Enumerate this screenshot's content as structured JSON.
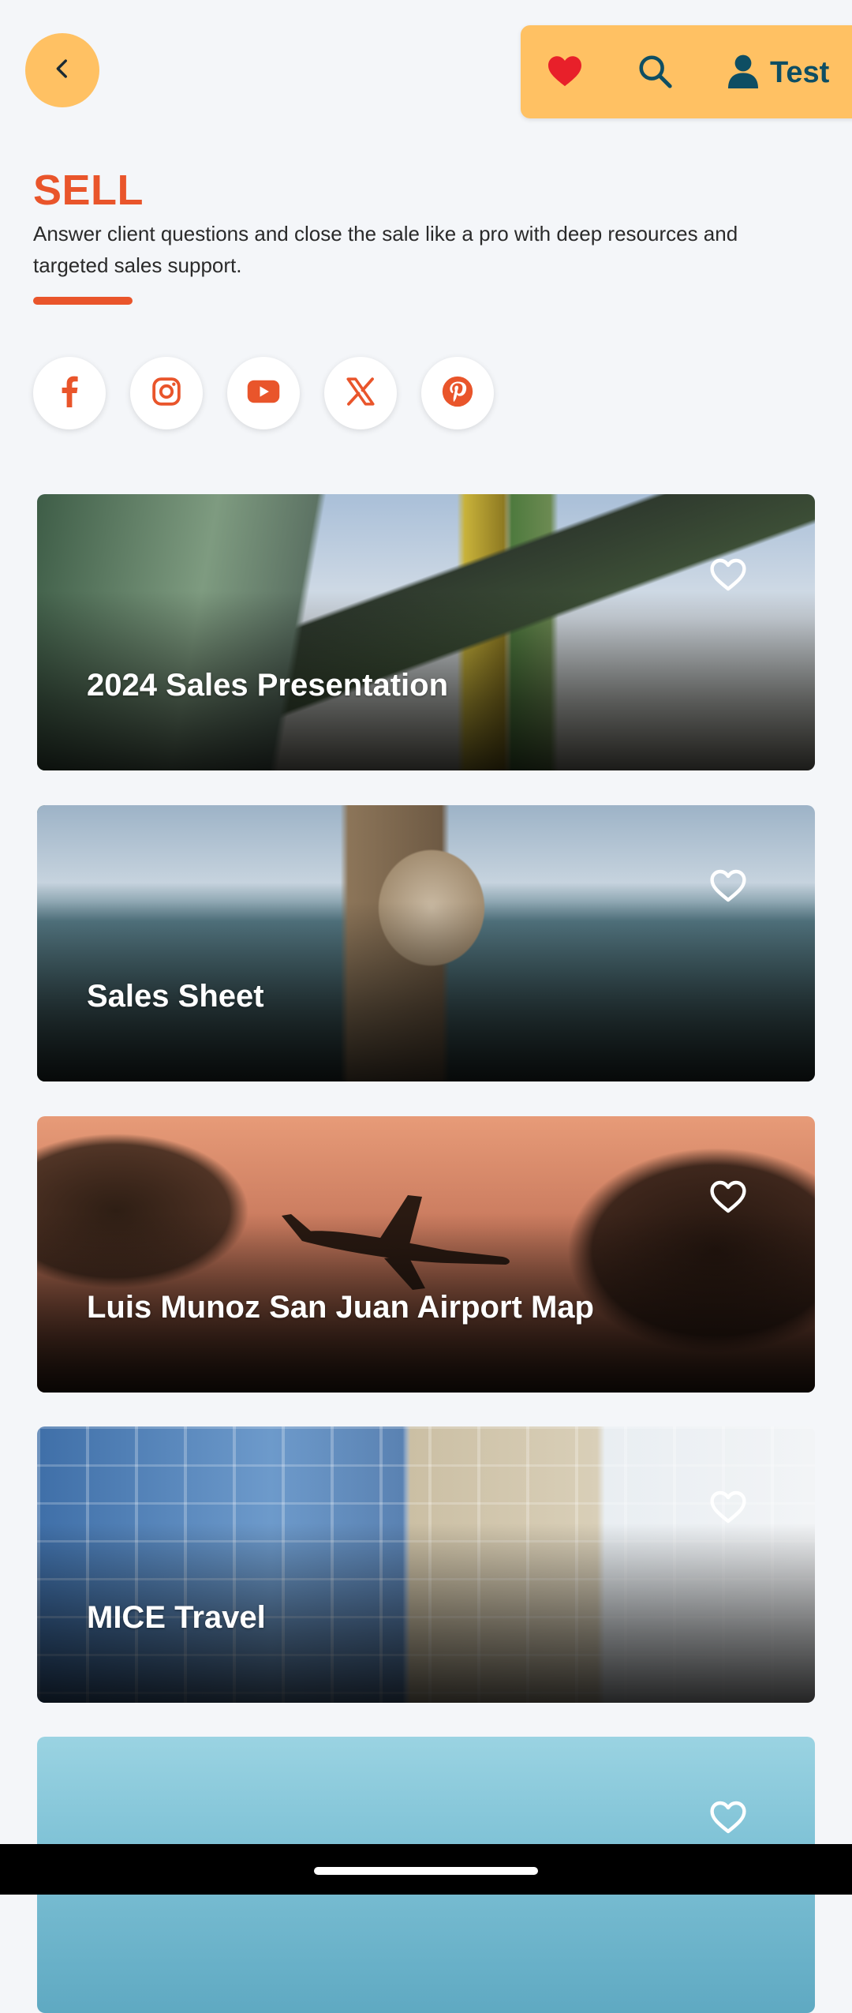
{
  "header": {
    "back_icon": "chevron-left-icon",
    "favorites_icon": "heart-icon",
    "search_icon": "search-icon",
    "user_icon": "user-icon",
    "user_name": "Test"
  },
  "section": {
    "title": "SELL",
    "description": "Answer client questions and close the sale like a pro with deep resources and targeted sales support."
  },
  "social": [
    {
      "icon": "facebook-icon"
    },
    {
      "icon": "instagram-icon"
    },
    {
      "icon": "youtube-icon"
    },
    {
      "icon": "x-icon"
    },
    {
      "icon": "pinterest-icon"
    }
  ],
  "cards": [
    {
      "title": "2024 Sales Presentation",
      "favorite": false
    },
    {
      "title": "Sales Sheet",
      "favorite": false
    },
    {
      "title": "Luis Munoz San Juan Airport Map",
      "favorite": false
    },
    {
      "title": "MICE Travel",
      "favorite": false
    },
    {
      "title": "",
      "favorite": false
    }
  ],
  "colors": {
    "accent": "#E9552B",
    "header_bg": "#FFC163",
    "heart": "#E8202A",
    "navy": "#0E4E63",
    "page_bg": "#F4F6F9"
  }
}
